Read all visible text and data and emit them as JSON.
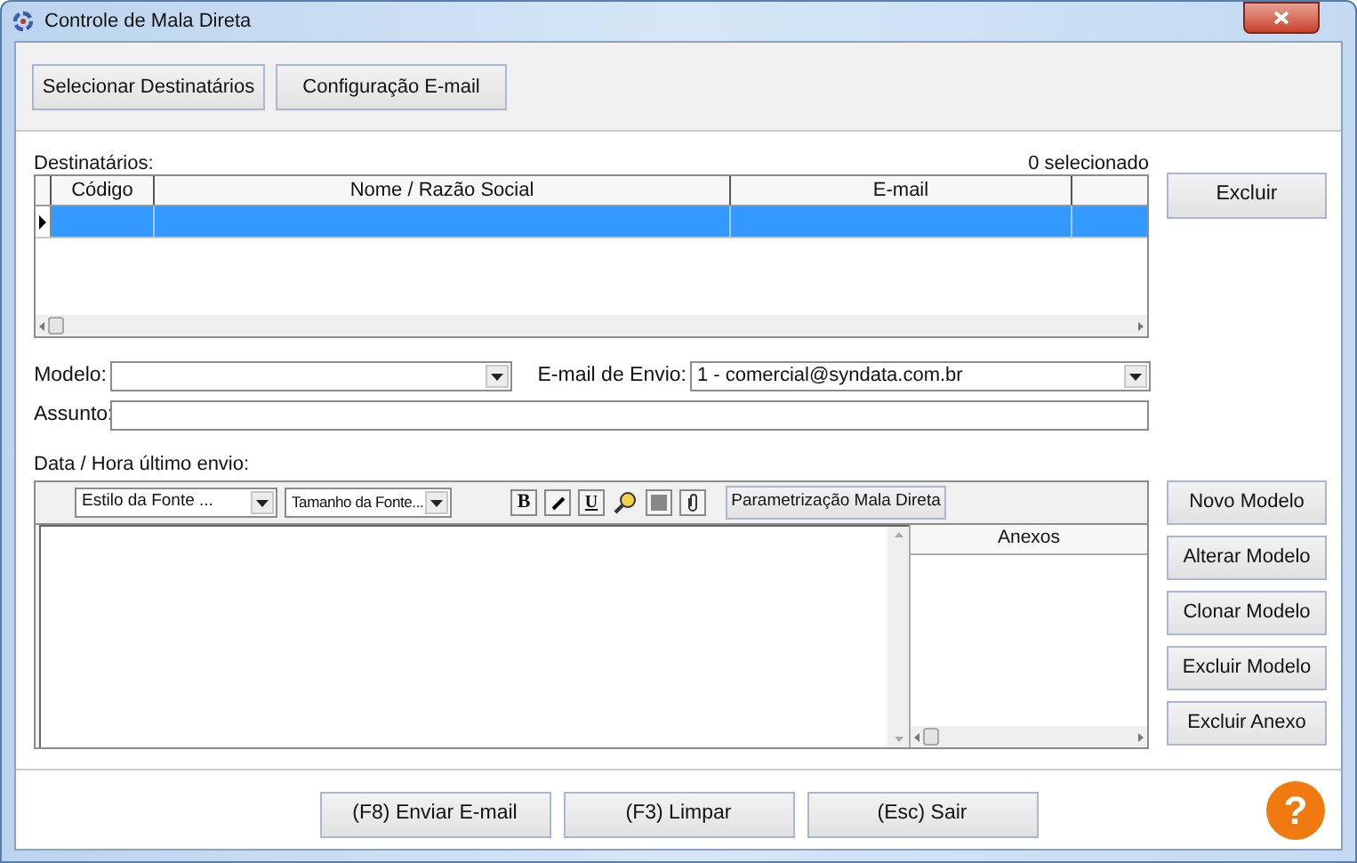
{
  "window": {
    "title": "Controle de Mala Direta"
  },
  "top_buttons": [
    "Selecionar Destinatários",
    "Configuração E-mail"
  ],
  "recipients": {
    "label": "Destinatários:",
    "count": "0 selecionado",
    "columns": [
      {
        "label": "Código"
      },
      {
        "label": "Nome / Razão Social"
      },
      {
        "label": "E-mail"
      }
    ],
    "rows": [
      {
        "selected": true
      }
    ]
  },
  "delete_button": "Excluir",
  "form": {
    "model": {
      "label": "Modelo:"
    },
    "sender": {
      "label": "E-mail de Envio:",
      "value": "1 - comercial@syndata.com.br"
    },
    "subject": {
      "label": "Assunto:"
    }
  },
  "last_sent": {
    "label": "Data / Hora último envio:"
  },
  "editor": {
    "font_style": {
      "value": "Estilo da Fonte ..."
    },
    "font_size": {
      "value": "Tamanho da Fonte..."
    },
    "format_buttons": [
      {
        "kind": "bold",
        "label": "B"
      },
      {
        "kind": "italic"
      },
      {
        "kind": "underline",
        "label": "U"
      },
      {
        "kind": "search"
      },
      {
        "kind": "color"
      },
      {
        "kind": "clip"
      }
    ],
    "param_button": "Parametrização Mala Direta",
    "attachments": {
      "header": "Anexos"
    }
  },
  "side_buttons": [
    "Novo Modelo",
    "Alterar Modelo",
    "Clonar Modelo",
    "Excluir Modelo",
    "Excluir Anexo"
  ],
  "bottom_buttons": [
    "(F8) Enviar E-mail",
    "(F3) Limpar",
    "(Esc) Sair"
  ],
  "help": {
    "label": "?"
  }
}
